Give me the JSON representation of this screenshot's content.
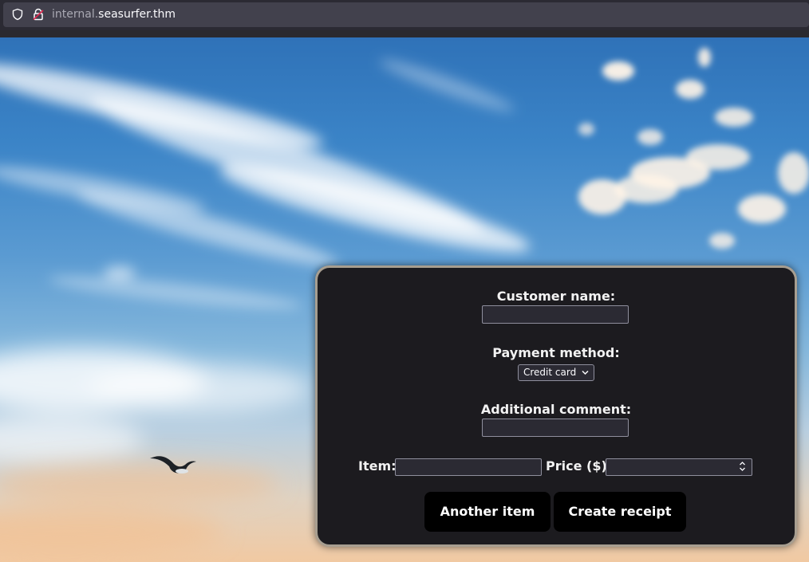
{
  "browser": {
    "url_subdomain": "internal.",
    "url_domain": "seasurfer.thm",
    "icons": [
      "shield-icon",
      "lock-icon"
    ]
  },
  "form": {
    "customer_name_label": "Customer name:",
    "customer_name_value": "",
    "payment_method_label": "Payment method:",
    "payment_method_selected": "Credit card",
    "comment_label": "Additional comment:",
    "comment_value": "",
    "item_label": "Item:",
    "item_value": "",
    "price_label": "Price ($):",
    "price_value": "",
    "another_item_button": "Another item",
    "create_receipt_button": "Create receipt"
  },
  "colors": {
    "panel_bg": "#1c1b1f",
    "panel_border": "#a79e90",
    "button_bg": "#000000",
    "input_bg": "#2b2a33"
  }
}
